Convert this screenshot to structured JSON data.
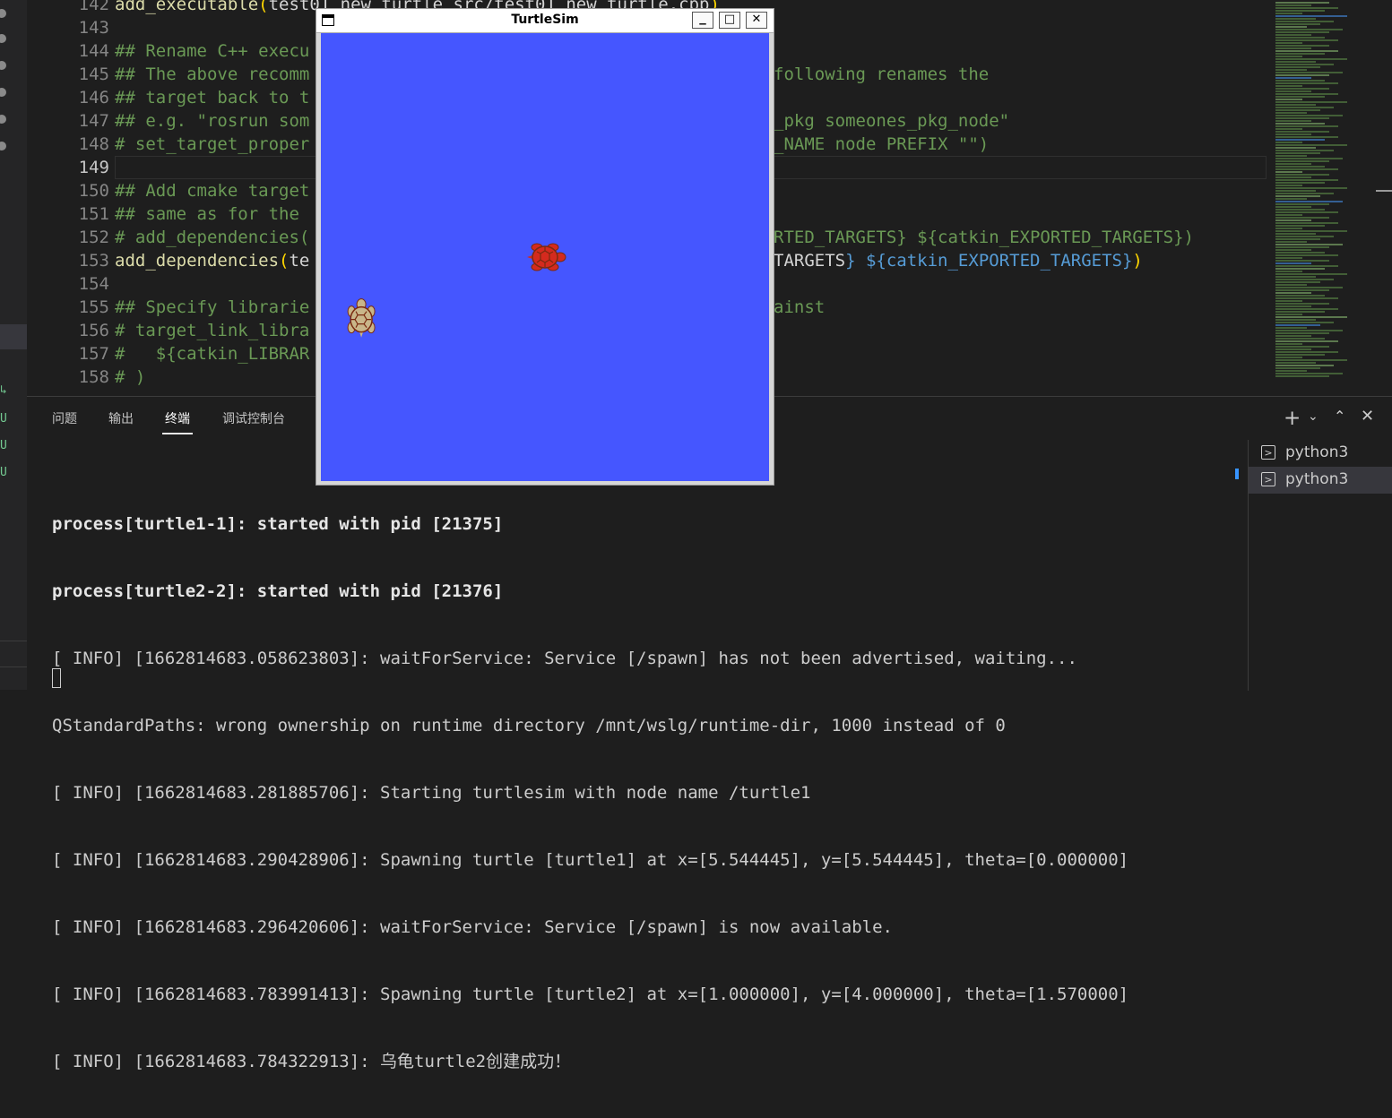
{
  "editor": {
    "lines": [
      {
        "num": "142",
        "text": "add_executable(test01_new_turtle src/test01_new_turtle.cpp)"
      },
      {
        "num": "143",
        "text": ""
      },
      {
        "num": "144",
        "text": "## Rename C++ execu"
      },
      {
        "num": "145",
        "text": "## The above recomm",
        "tail": "following renames the"
      },
      {
        "num": "146",
        "text": "## target back to t"
      },
      {
        "num": "147",
        "text": "## e.g. \"rosrun som",
        "tail": "_pkg someones_pkg_node\""
      },
      {
        "num": "148",
        "text": "# set_target_proper",
        "tail": "_NAME node PREFIX \"\")"
      },
      {
        "num": "149",
        "text": ""
      },
      {
        "num": "150",
        "text": "## Add cmake target"
      },
      {
        "num": "151",
        "text": "## same as for the"
      },
      {
        "num": "152",
        "text": "# add_dependencies(",
        "tail": "RTED_TARGETS} ${catkin_EXPORTED_TARGETS})"
      },
      {
        "num": "153",
        "text": "add_dependencies(te",
        "tail": "TARGETS} ${catkin_EXPORTED_TARGETS})"
      },
      {
        "num": "154",
        "text": ""
      },
      {
        "num": "155",
        "text": "## Specify librarie",
        "tail": "ainst"
      },
      {
        "num": "156",
        "text": "# target_link_libra"
      },
      {
        "num": "157",
        "text": "#   ${catkin_LIBRAR"
      },
      {
        "num": "158",
        "text": "# )"
      }
    ]
  },
  "panel": {
    "tabs": [
      "问题",
      "输出",
      "终端",
      "调试控制台"
    ],
    "active_tab": "终端",
    "icons": [
      "add-terminal-icon",
      "chevron-down-icon",
      "maximize-panel-icon",
      "close-panel-icon"
    ],
    "terminal_lines": [
      "process[turtle1-1]: started with pid [21375]",
      "process[turtle2-2]: started with pid [21376]",
      "[ INFO] [1662814683.058623803]: waitForService: Service [/spawn] has not been advertised, waiting...",
      "QStandardPaths: wrong ownership on runtime directory /mnt/wslg/runtime-dir, 1000 instead of 0",
      "[ INFO] [1662814683.281885706]: Starting turtlesim with node name /turtle1",
      "[ INFO] [1662814683.290428906]: Spawning turtle [turtle1] at x=[5.544445], y=[5.544445], theta=[0.000000]",
      "[ INFO] [1662814683.296420606]: waitForService: Service [/spawn] is now available.",
      "[ INFO] [1662814683.783991413]: Spawning turtle [turtle2] at x=[1.000000], y=[4.000000], theta=[1.570000]",
      "[ INFO] [1662814683.784322913]: 乌龟turtle2创建成功！"
    ],
    "terminal_instances": [
      "python3",
      "python3"
    ]
  },
  "turtlesim": {
    "title": "TurtleSim",
    "buttons": {
      "minimize": "_",
      "maximize": "□",
      "close": "✕"
    },
    "background": "#4556ff",
    "world_size": 11.088889,
    "turtles": [
      {
        "name": "turtle1",
        "x": 5.544445,
        "y": 5.544445,
        "theta": 0.0,
        "color": "#d42a1e"
      },
      {
        "name": "turtle2",
        "x": 1.0,
        "y": 4.0,
        "theta": 1.57,
        "color": "#c9b68a"
      }
    ]
  },
  "activity": {
    "status_marks": [
      "U",
      "U",
      "U"
    ],
    "branch_mark": "↳"
  }
}
